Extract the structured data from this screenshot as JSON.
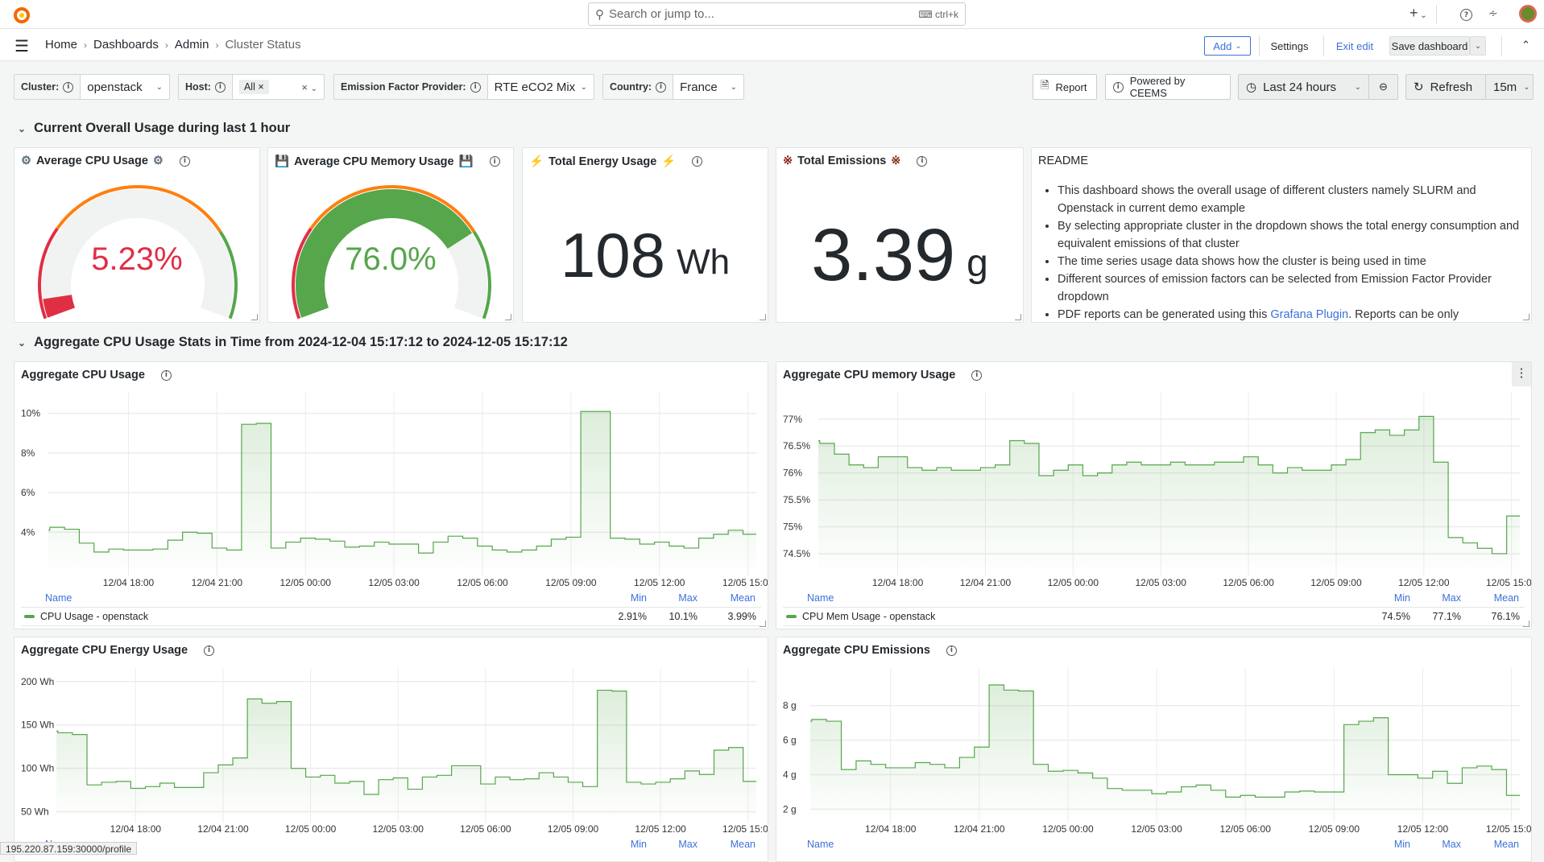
{
  "topbar": {
    "search_placeholder": "Search or jump to...",
    "search_shortcut": "ctrl+k",
    "icons": [
      "grafana-logo-icon",
      "search-icon",
      "keyboard-icon",
      "plus-icon",
      "help-icon",
      "rss-icon",
      "avatar"
    ]
  },
  "breadcrumb": [
    "Home",
    "Dashboards",
    "Admin",
    "Cluster Status"
  ],
  "toolbar": {
    "add": "Add",
    "settings": "Settings",
    "exit_edit": "Exit edit",
    "save": "Save dashboard"
  },
  "variables": [
    {
      "label": "Cluster:",
      "value": "openstack"
    },
    {
      "label": "Host:",
      "value": "All"
    },
    {
      "label": "Emission Factor Provider:",
      "value": "RTE eCO2 Mix"
    },
    {
      "label": "Country:",
      "value": "France"
    }
  ],
  "controls": {
    "report": "Report",
    "powered": "Powered by CEEMS",
    "time_range": "Last 24 hours",
    "refresh": "Refresh",
    "interval": "15m"
  },
  "sections": [
    {
      "title": "Current Overall Usage during last 1 hour"
    },
    {
      "title": "Aggregate CPU Usage Stats in Time from 2024-12-04 15:17:12 to 2024-12-05 15:17:12"
    }
  ],
  "stats": {
    "cpu": {
      "title": "Average CPU Usage",
      "value": "5.23%",
      "fraction": 0.0523,
      "color": "#e02f44"
    },
    "mem": {
      "title": "Average CPU Memory Usage",
      "value": "76.0%",
      "fraction": 0.76,
      "color": "#56a64b"
    },
    "energy": {
      "title": "Total Energy Usage",
      "value": "108",
      "unit": "Wh"
    },
    "emissions": {
      "title": "Total Emissions",
      "value": "3.39",
      "unit": "g"
    },
    "threshold_colors": {
      "low": "#e02f44",
      "mid": "#ff7f0e",
      "high": "#56a64b"
    }
  },
  "readme": {
    "title": "README",
    "items": [
      "This dashboard shows the overall usage of different clusters namely SLURM and Openstack in current demo example",
      "By selecting appropriate cluster in the dropdown shows the total energy consumption and equivalent emissions of that cluster",
      "The time series usage data shows how the cluster is being used in time",
      "Different sources of emission factors can be selected from Emission Factor Provider dropdown"
    ],
    "last_prefix": "PDF reports can be generated using this ",
    "last_link": "Grafana Plugin",
    "last_suffix": ". Reports can be only"
  },
  "legend_headers": {
    "name": "Name",
    "min": "Min",
    "max": "Max",
    "mean": "Mean"
  },
  "chart_data": [
    {
      "type": "line",
      "title": "Aggregate CPU Usage",
      "color": "#56a64b",
      "xlim": [
        "12/04 15:17",
        "12/05 15:17"
      ],
      "xticks": [
        "12/04 18:00",
        "12/04 21:00",
        "12/05 00:00",
        "12/05 03:00",
        "12/05 06:00",
        "12/05 09:00",
        "12/05 12:00",
        "12/05 15:00"
      ],
      "ylim": [
        2.1,
        10.8
      ],
      "yticks": [
        4,
        6,
        8,
        10
      ],
      "ytick_labels": [
        "4%",
        "6%",
        "8%",
        "10%"
      ],
      "x": [
        "12/04 15:20",
        "12/04 15:50",
        "12/04 16:20",
        "12/04 16:50",
        "12/04 17:20",
        "12/04 17:50",
        "12/04 18:20",
        "12/04 18:50",
        "12/04 19:20",
        "12/04 19:50",
        "12/04 20:20",
        "12/04 20:50",
        "12/04 21:20",
        "12/04 21:50",
        "12/04 22:20",
        "12/04 22:50",
        "12/04 23:20",
        "12/04 23:50",
        "12/05 00:20",
        "12/05 00:50",
        "12/05 01:20",
        "12/05 01:50",
        "12/05 02:20",
        "12/05 02:50",
        "12/05 03:20",
        "12/05 03:50",
        "12/05 04:20",
        "12/05 04:50",
        "12/05 05:20",
        "12/05 05:50",
        "12/05 06:20",
        "12/05 06:50",
        "12/05 07:20",
        "12/05 07:50",
        "12/05 08:20",
        "12/05 08:50",
        "12/05 09:20",
        "12/05 09:50",
        "12/05 10:20",
        "12/05 10:50",
        "12/05 11:20",
        "12/05 11:50",
        "12/05 12:20",
        "12/05 12:50",
        "12/05 13:20",
        "12/05 13:50",
        "12/05 14:20",
        "12/05 14:50",
        "12/05 15:20"
      ],
      "series": [
        {
          "name": "CPU Usage - openstack",
          "min": "2.91%",
          "max": "10.1%",
          "mean": "3.99%",
          "values": [
            4.1,
            4.25,
            4.15,
            3.45,
            3.0,
            3.15,
            3.1,
            3.1,
            3.15,
            3.6,
            4.0,
            3.95,
            3.2,
            3.1,
            9.45,
            9.5,
            3.2,
            3.5,
            3.7,
            3.65,
            3.55,
            3.25,
            3.3,
            3.5,
            3.4,
            3.4,
            2.95,
            3.5,
            3.8,
            3.7,
            3.3,
            3.1,
            3.0,
            3.1,
            3.3,
            3.65,
            3.75,
            10.1,
            10.1,
            3.7,
            3.65,
            3.4,
            3.5,
            3.3,
            3.2,
            3.7,
            3.9,
            4.1,
            3.9
          ]
        }
      ]
    },
    {
      "type": "line",
      "title": "Aggregate CPU memory Usage",
      "color": "#56a64b",
      "xlim": [
        "12/04 15:17",
        "12/05 15:17"
      ],
      "xticks": [
        "12/04 18:00",
        "12/04 21:00",
        "12/05 00:00",
        "12/05 03:00",
        "12/05 06:00",
        "12/05 09:00",
        "12/05 12:00",
        "12/05 15:00"
      ],
      "ylim": [
        74.2,
        77.4
      ],
      "yticks": [
        74.5,
        75,
        75.5,
        76,
        76.5,
        77
      ],
      "ytick_labels": [
        "74.5%",
        "75%",
        "75.5%",
        "76%",
        "76.5%",
        "77%"
      ],
      "x": [
        "12/04 15:20",
        "12/04 15:50",
        "12/04 16:20",
        "12/04 16:50",
        "12/04 17:20",
        "12/04 17:50",
        "12/04 18:20",
        "12/04 18:50",
        "12/04 19:20",
        "12/04 19:50",
        "12/04 20:20",
        "12/04 20:50",
        "12/04 21:20",
        "12/04 21:50",
        "12/04 22:20",
        "12/04 22:50",
        "12/04 23:20",
        "12/04 23:50",
        "12/05 00:20",
        "12/05 00:50",
        "12/05 01:20",
        "12/05 01:50",
        "12/05 02:20",
        "12/05 02:50",
        "12/05 03:20",
        "12/05 03:50",
        "12/05 04:20",
        "12/05 04:50",
        "12/05 05:20",
        "12/05 05:50",
        "12/05 06:20",
        "12/05 06:50",
        "12/05 07:20",
        "12/05 07:50",
        "12/05 08:20",
        "12/05 08:50",
        "12/05 09:20",
        "12/05 09:50",
        "12/05 10:20",
        "12/05 10:50",
        "12/05 11:20",
        "12/05 11:50",
        "12/05 12:20",
        "12/05 12:50",
        "12/05 13:20",
        "12/05 13:50",
        "12/05 14:20",
        "12/05 14:50",
        "12/05 15:20"
      ],
      "series": [
        {
          "name": "CPU Mem Usage - openstack",
          "min": "74.5%",
          "max": "77.1%",
          "mean": "76.1%",
          "values": [
            76.6,
            76.55,
            76.35,
            76.15,
            76.1,
            76.3,
            76.3,
            76.1,
            76.05,
            76.1,
            76.05,
            76.05,
            76.1,
            76.15,
            76.6,
            76.55,
            75.95,
            76.05,
            76.15,
            75.95,
            76.0,
            76.15,
            76.2,
            76.15,
            76.15,
            76.2,
            76.15,
            76.15,
            76.2,
            76.2,
            76.3,
            76.15,
            76.0,
            76.1,
            76.05,
            76.05,
            76.15,
            76.25,
            76.75,
            76.8,
            76.7,
            76.8,
            77.05,
            76.2,
            74.8,
            74.7,
            74.6,
            74.5,
            75.2
          ]
        }
      ]
    },
    {
      "type": "line",
      "title": "Aggregate CPU Energy Usage",
      "color": "#56a64b",
      "xlim": [
        "12/04 15:17",
        "12/05 15:17"
      ],
      "xticks": [
        "12/04 18:00",
        "12/04 21:00",
        "12/05 00:00",
        "12/05 03:00",
        "12/05 06:00",
        "12/05 09:00",
        "12/05 12:00",
        "12/05 15:00"
      ],
      "ylim": [
        45,
        210
      ],
      "yticks": [
        50,
        100,
        150,
        200
      ],
      "ytick_labels": [
        "50 Wh",
        "100 Wh",
        "150 Wh",
        "200 Wh"
      ],
      "x": [
        "12/04 15:20",
        "12/04 15:50",
        "12/04 16:20",
        "12/04 16:50",
        "12/04 17:20",
        "12/04 17:50",
        "12/04 18:20",
        "12/04 18:50",
        "12/04 19:20",
        "12/04 19:50",
        "12/04 20:20",
        "12/04 20:50",
        "12/04 21:20",
        "12/04 21:50",
        "12/04 22:20",
        "12/04 22:50",
        "12/04 23:20",
        "12/04 23:50",
        "12/05 00:20",
        "12/05 00:50",
        "12/05 01:20",
        "12/05 01:50",
        "12/05 02:20",
        "12/05 02:50",
        "12/05 03:20",
        "12/05 03:50",
        "12/05 04:20",
        "12/05 04:50",
        "12/05 05:20",
        "12/05 05:50",
        "12/05 06:20",
        "12/05 06:50",
        "12/05 07:20",
        "12/05 07:50",
        "12/05 08:20",
        "12/05 08:50",
        "12/05 09:20",
        "12/05 09:50",
        "12/05 10:20",
        "12/05 10:50",
        "12/05 11:20",
        "12/05 11:50",
        "12/05 12:20",
        "12/05 12:50",
        "12/05 13:20",
        "12/05 13:50",
        "12/05 14:20",
        "12/05 14:50",
        "12/05 15:20"
      ],
      "series": [
        {
          "values": [
            143,
            141,
            139,
            81,
            84,
            85,
            77,
            79,
            83,
            78,
            78,
            95,
            104,
            112,
            180,
            175,
            177,
            100,
            90,
            92,
            83,
            85,
            70,
            87,
            89,
            76,
            90,
            92,
            103,
            103,
            82,
            90,
            87,
            88,
            95,
            90,
            84,
            79,
            190,
            189,
            84,
            82,
            84,
            88,
            97,
            93,
            121,
            124,
            85
          ]
        }
      ]
    },
    {
      "type": "line",
      "title": "Aggregate CPU Emissions",
      "color": "#56a64b",
      "xlim": [
        "12/04 15:17",
        "12/05 15:17"
      ],
      "xticks": [
        "12/04 18:00",
        "12/04 21:00",
        "12/05 00:00",
        "12/05 03:00",
        "12/05 06:00",
        "12/05 09:00",
        "12/05 12:00",
        "12/05 15:00"
      ],
      "ylim": [
        1.6,
        9.9
      ],
      "yticks": [
        2,
        4,
        6,
        8
      ],
      "ytick_labels": [
        "2 g",
        "4 g",
        "6 g",
        "8 g"
      ],
      "x": [
        "12/04 15:20",
        "12/04 15:50",
        "12/04 16:20",
        "12/04 16:50",
        "12/04 17:20",
        "12/04 17:50",
        "12/04 18:20",
        "12/04 18:50",
        "12/04 19:20",
        "12/04 19:50",
        "12/04 20:20",
        "12/04 20:50",
        "12/04 21:20",
        "12/04 21:50",
        "12/04 22:20",
        "12/04 22:50",
        "12/04 23:20",
        "12/04 23:50",
        "12/05 00:20",
        "12/05 00:50",
        "12/05 01:20",
        "12/05 01:50",
        "12/05 02:20",
        "12/05 02:50",
        "12/05 03:20",
        "12/05 03:50",
        "12/05 04:20",
        "12/05 04:50",
        "12/05 05:20",
        "12/05 05:50",
        "12/05 06:20",
        "12/05 06:50",
        "12/05 07:20",
        "12/05 07:50",
        "12/05 08:20",
        "12/05 08:50",
        "12/05 09:20",
        "12/05 09:50",
        "12/05 10:20",
        "12/05 10:50",
        "12/05 11:20",
        "12/05 11:50",
        "12/05 12:20",
        "12/05 12:50",
        "12/05 13:20",
        "12/05 13:50",
        "12/05 14:20",
        "12/05 14:50",
        "12/05 15:20"
      ],
      "series": [
        {
          "values": [
            7.1,
            7.2,
            7.1,
            4.3,
            4.8,
            4.6,
            4.4,
            4.4,
            4.7,
            4.6,
            4.4,
            5.0,
            5.6,
            9.2,
            8.9,
            8.85,
            4.6,
            4.2,
            4.25,
            4.1,
            3.8,
            3.2,
            3.1,
            3.1,
            2.9,
            3.0,
            3.3,
            3.4,
            3.1,
            2.7,
            2.8,
            2.7,
            2.7,
            3.0,
            3.05,
            3.0,
            3.0,
            6.9,
            7.1,
            7.3,
            4.0,
            4.0,
            3.8,
            4.2,
            3.5,
            4.4,
            4.5,
            4.3,
            2.8
          ]
        }
      ]
    }
  ],
  "status_url": "195.220.87.159:30000/profile"
}
